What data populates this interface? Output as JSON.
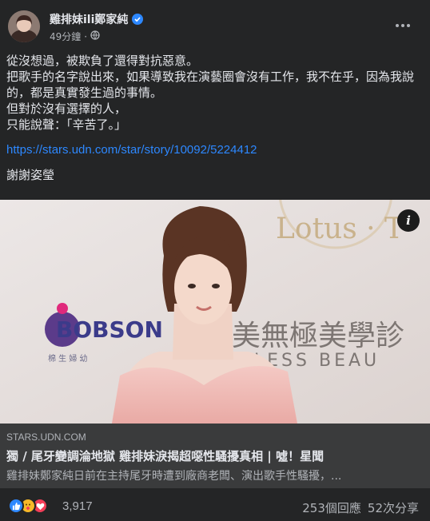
{
  "header": {
    "author": "雞排妹ili鄭家純",
    "time": "49分鐘",
    "separator": "·"
  },
  "post": {
    "lines": [
      "從沒想過，被欺負了還得對抗惡意。",
      "把歌手的名字說出來，如果導致我在演藝圈會沒有工作，我不在乎，因為我說的，都是真實發生過的事情。",
      "但對於沒有選擇的人，",
      "只能說聲：「辛苦了。」"
    ],
    "link": "https://stars.udn.com/star/story/10092/5224412",
    "thanks": "謝謝姿瑩"
  },
  "photo": {
    "sign_text_1": "Lotus · T",
    "sign_text_2": "美無極美學診",
    "sign_text_3": "ELESS BEAU",
    "sponsor": "BOBSON",
    "sponsor_sub": "棉 生 婦 幼"
  },
  "preview": {
    "domain": "STARS.UDN.COM",
    "headline": "獨 / 尾牙變調淪地獄 雞排妹淚揭超噁性騷擾真相 | 噓！星聞",
    "description": "雞排妹鄭家純日前在主持尾牙時遭到廠商老闆、演出歌手性騷擾，..."
  },
  "stats": {
    "reaction_count": "3,917",
    "comments": "253個回應",
    "shares": "52次分享"
  },
  "colors": {
    "background": "#242526",
    "link": "#2d88ff",
    "like": "#2d88ff",
    "care": "#f7b928",
    "love": "#f33e58"
  }
}
